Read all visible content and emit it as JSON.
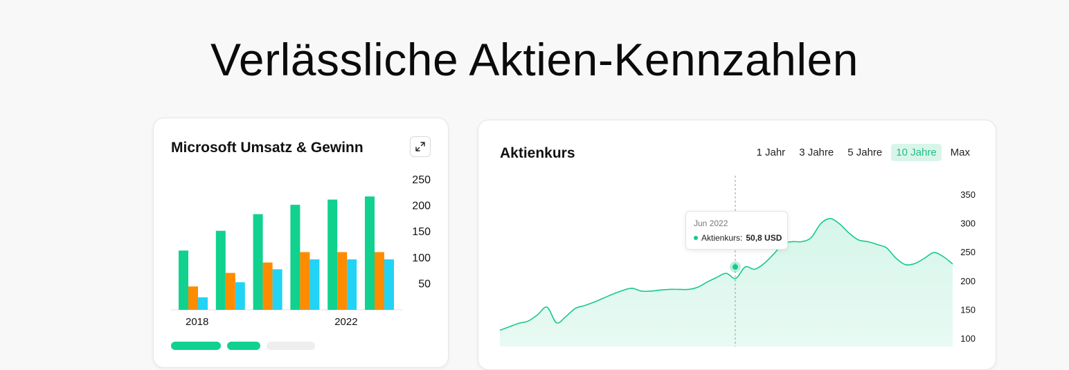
{
  "headline": "Verlässliche Aktien-Kennzahlen",
  "colors": {
    "revenue": "#11d18f",
    "profit": "#ff8c00",
    "third": "#22d3f5",
    "price_line": "#16c98a",
    "price_fill": "#d6f6ea",
    "active_tab_bg": "#d9f5ea"
  },
  "left_card": {
    "title": "Microsoft Umsatz & Gewinn",
    "expand_icon": "expand-arrows-icon",
    "pills": [
      {
        "color": "#11d18f"
      },
      {
        "color": "#11d18f"
      },
      {
        "color": "#eeeeee"
      }
    ]
  },
  "right_card": {
    "title": "Aktienkurs",
    "tabs": [
      "1 Jahr",
      "3 Jahre",
      "5 Jahre",
      "10 Jahre",
      "Max"
    ],
    "active_tab": "10 Jahre",
    "tooltip": {
      "date": "Jun 2022",
      "label": "Aktienkurs:",
      "value": "50,8 USD"
    }
  },
  "chart_data": [
    {
      "type": "bar",
      "title": "Microsoft Umsatz & Gewinn",
      "x_tick_labels": [
        "2018",
        "",
        "",
        "",
        "2022",
        ""
      ],
      "series": [
        {
          "color": "#11d18f",
          "values": [
            114,
            152,
            184,
            202,
            212,
            218
          ]
        },
        {
          "color": "#ff8c00",
          "values": [
            45,
            71,
            91,
            111,
            111,
            111
          ]
        },
        {
          "color": "#22d3f5",
          "values": [
            24,
            53,
            78,
            97,
            97,
            97
          ]
        }
      ],
      "yticks": [
        50,
        100,
        150,
        200,
        250
      ],
      "ylim": [
        0,
        250
      ],
      "y_axis_position": "right",
      "grid": false
    },
    {
      "type": "area",
      "title": "Aktienkurs",
      "x_tick_labels": [],
      "yticks": [
        100,
        150,
        200,
        250,
        300,
        350
      ],
      "ylim": [
        100,
        350
      ],
      "y_axis_position": "right",
      "grid": false,
      "series": [
        {
          "color": "#16c98a",
          "values": [
            115,
            121,
            127,
            131,
            142,
            155,
            128,
            139,
            153,
            158,
            164,
            171,
            178,
            184,
            188,
            183,
            183,
            185,
            186,
            186,
            186,
            190,
            199,
            207,
            214,
            205,
            225,
            221,
            231,
            247,
            265,
            269,
            269,
            276,
            300,
            309,
            300,
            284,
            272,
            269,
            264,
            258,
            240,
            229,
            231,
            240,
            250,
            243,
            230
          ]
        }
      ],
      "highlight": {
        "index": 26,
        "label": "Jun 2022"
      }
    }
  ]
}
